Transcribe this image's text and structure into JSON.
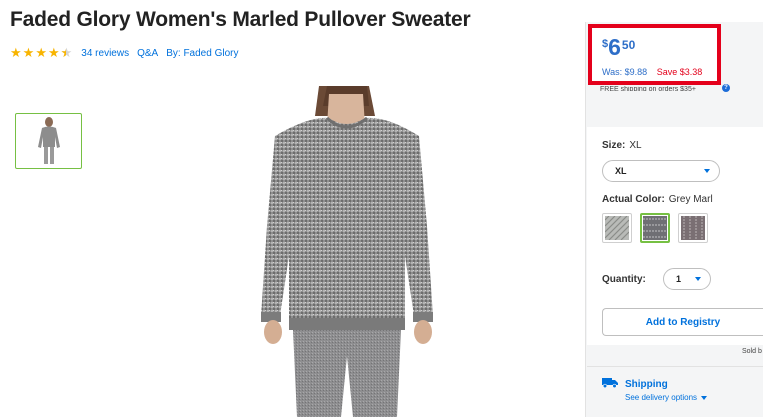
{
  "product": {
    "title": "Faded Glory Women's Marled Pullover Sweater",
    "rating": 4.5,
    "reviews_label": "34 reviews",
    "qa_label": "Q&A",
    "brand_label": "By: Faded Glory"
  },
  "price": {
    "currency": "$",
    "dollars": "6",
    "cents": "50",
    "was": "Was: $9.88",
    "save": "Save $3.38",
    "shipping_note": "FREE shipping on orders $35+"
  },
  "options": {
    "size_label": "Size:",
    "size_value": "XL",
    "size_selected": "XL",
    "color_label": "Actual Color:",
    "color_value": "Grey Marl",
    "swatches": [
      {
        "name": "swatch-1",
        "selected": false,
        "color": "#b9bbb8"
      },
      {
        "name": "swatch-2",
        "selected": true,
        "color": "#6f6f74"
      },
      {
        "name": "swatch-3",
        "selected": false,
        "color": "#7a6f73"
      }
    ],
    "quantity_label": "Quantity:",
    "quantity_value": "1"
  },
  "actions": {
    "registry": "Add to Registry",
    "sold_by": "Sold b"
  },
  "shipping": {
    "title": "Shipping",
    "delivery": "See delivery options"
  },
  "colors": {
    "accent_blue": "#0071dc",
    "price_blue": "#2d6ec8",
    "alert_red": "#e4001b",
    "star_yellow": "#f8b400",
    "selected_green": "#76c043"
  }
}
